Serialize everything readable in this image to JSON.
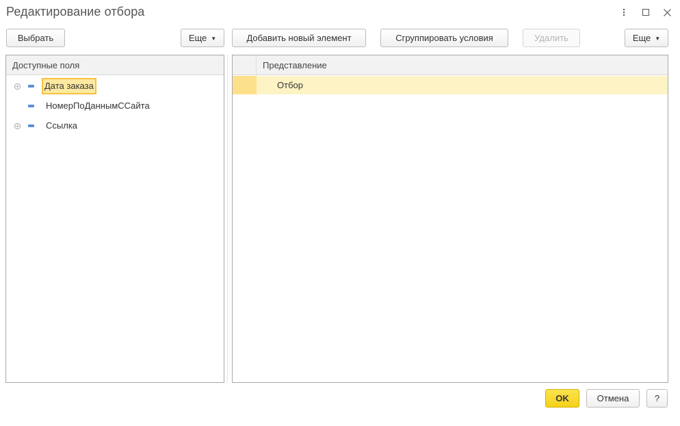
{
  "window": {
    "title": "Редактирование отбора",
    "menu_icon": "more-vertical-icon",
    "maximize_icon": "maximize-icon",
    "close_icon": "close-icon"
  },
  "left_toolbar": {
    "select_label": "Выбрать",
    "more_label": "Еще"
  },
  "right_toolbar": {
    "add_label": "Добавить новый элемент",
    "group_label": "Сгруппировать условия",
    "delete_label": "Удалить",
    "more_label": "Еще"
  },
  "fields_panel": {
    "header": "Доступные поля",
    "items": [
      {
        "label": "Дата заказа",
        "expandable": true,
        "selected": true
      },
      {
        "label": "НомерПоДаннымССайта",
        "expandable": false,
        "selected": false
      },
      {
        "label": "Ссылка",
        "expandable": true,
        "selected": false
      }
    ]
  },
  "filter_panel": {
    "header": "Представление",
    "rows": [
      {
        "label": "Отбор"
      }
    ]
  },
  "footer": {
    "ok_label": "OK",
    "cancel_label": "Отмена",
    "help_label": "?"
  },
  "colors": {
    "accent_yellow": "#f5d119",
    "selection_fill": "#fde9a0",
    "selection_border": "#f5c242",
    "row_highlight": "#fdf3c4",
    "field_icon": "#5b8fd1"
  }
}
